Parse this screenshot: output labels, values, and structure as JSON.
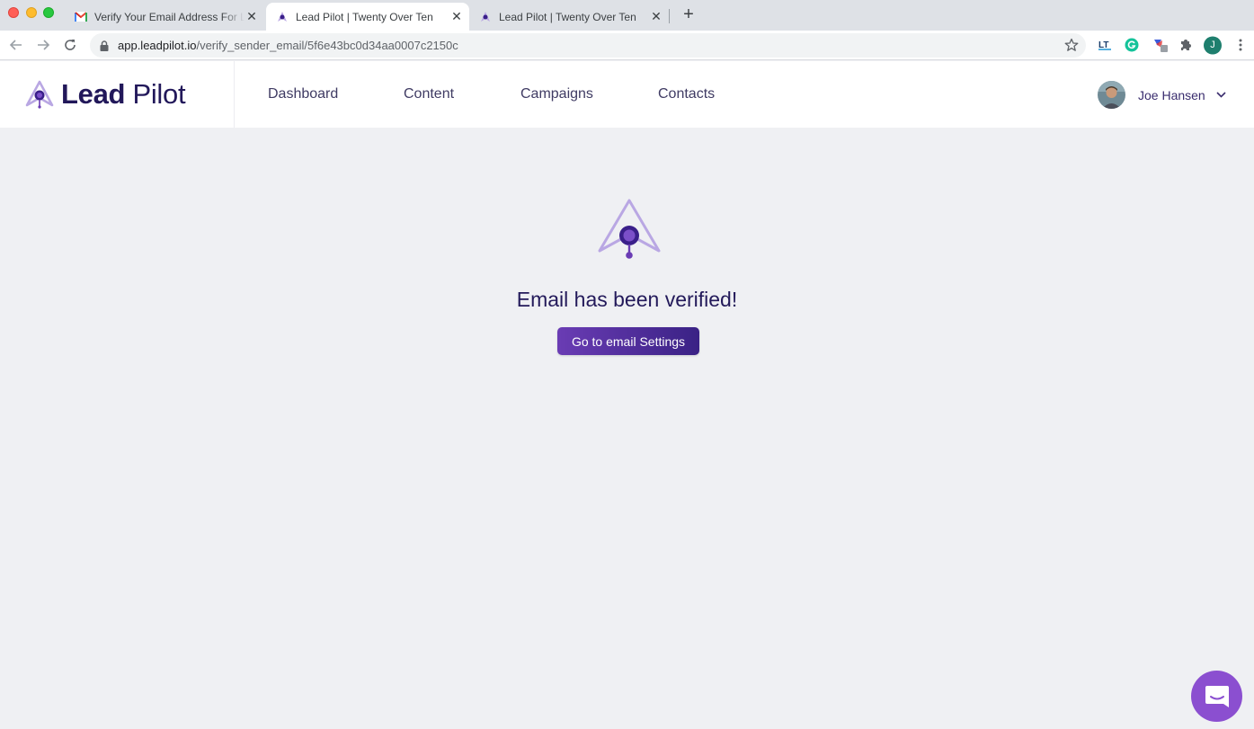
{
  "browser": {
    "tabs": [
      {
        "title": "Verify Your Email Address For Lead Pilot",
        "favicon": "gmail-icon",
        "active": false
      },
      {
        "title": "Lead Pilot | Twenty Over Ten",
        "favicon": "leadpilot-icon",
        "active": true
      },
      {
        "title": "Lead Pilot | Twenty Over Ten",
        "favicon": "leadpilot-icon",
        "active": false
      }
    ],
    "url_host": "app.leadpilot.io",
    "url_path": "/verify_sender_email/5f6e43bc0d34aa0007c2150c",
    "profile_initial": "J"
  },
  "header": {
    "logo_bold": "Lead",
    "logo_light": " Pilot",
    "nav": [
      "Dashboard",
      "Content",
      "Campaigns",
      "Contacts"
    ],
    "user_name": "Joe Hansen"
  },
  "main": {
    "headline": "Email has been verified!",
    "cta_label": "Go to email Settings"
  },
  "colors": {
    "brand_dark": "#22185a",
    "brand_purple": "#5b2fa8",
    "brand_light": "#b9a7e3",
    "chat": "#8b4fd0",
    "page_bg": "#eff0f3"
  }
}
